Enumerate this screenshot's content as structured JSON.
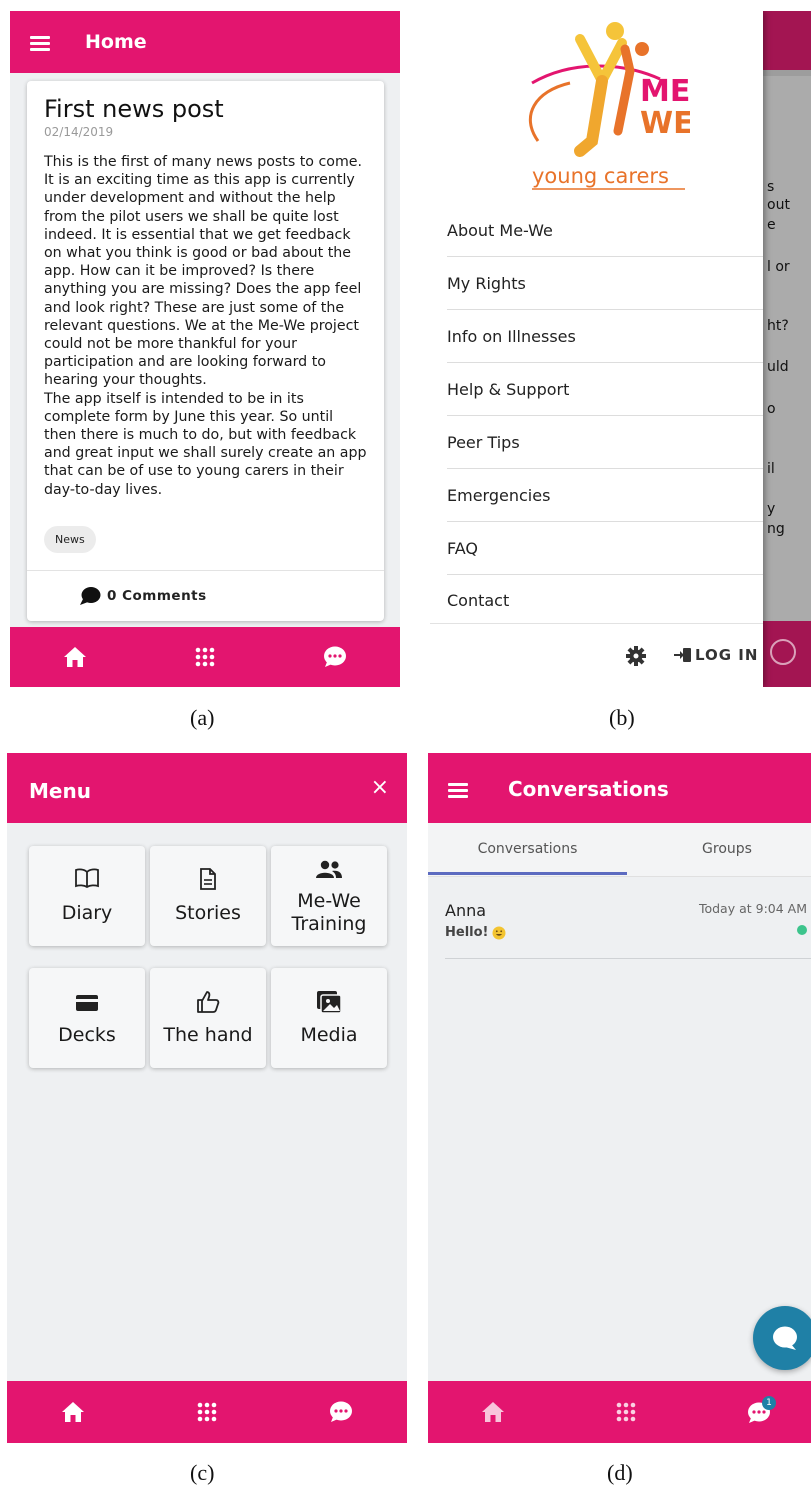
{
  "colors": {
    "brand_pink": "#e3156f",
    "fab_blue": "#1f80a6",
    "tab_underline": "#5c6bc0",
    "online_green": "#3cc48c"
  },
  "captions": {
    "a": "(a)",
    "b": "(b)",
    "c": "(c)",
    "d": "(d)"
  },
  "panel_a": {
    "header_title": "Home",
    "post": {
      "title": "First news post",
      "date": "02/14/2019",
      "body": "This is the first of many news posts to come.\nIt is an exciting time as this app is currently\nunder development and without the help\nfrom the pilot users we shall be quite lost\nindeed. It is essential that we get feedback\non what you think is good or bad about the\napp. How can it be improved? Is there\nanything you are missing? Does the app feel\nand look right? These are just some of the\nrelevant questions. We at the Me-We project\ncould not be more thankful for your\nparticipation and are looking forward to\nhearing your thoughts.\nThe app itself is intended to be in its\ncomplete form by June this year. So until\nthen there is much to do, but with feedback\nand great input we shall surely create an app\nthat can be of use to young carers in their\nday-to-day lives.",
      "tag": "News",
      "comments": "0 Comments"
    },
    "bottom_nav": [
      "home-icon",
      "apps-grid-icon",
      "chat-icon"
    ]
  },
  "panel_b": {
    "logo": {
      "line1": "ME",
      "line2": "WE",
      "tagline": "young carers"
    },
    "menu_items": [
      "About Me-We",
      "My Rights",
      "Info on Illnesses",
      "Help & Support",
      "Peer Tips",
      "Emergencies",
      "FAQ",
      "Contact"
    ],
    "login_label": "LOG IN",
    "background_fragments": [
      "s",
      "out",
      "e",
      "l or",
      "ht?",
      "uld",
      "o",
      "il",
      "y",
      "ng"
    ]
  },
  "panel_c": {
    "header_title": "Menu",
    "close_symbol": "×",
    "tiles": [
      {
        "label": "Diary",
        "icon": "book-icon"
      },
      {
        "label": "Stories",
        "icon": "document-icon"
      },
      {
        "label": "Me-We Training",
        "icon": "people-icon"
      },
      {
        "label": "Decks",
        "icon": "card-icon"
      },
      {
        "label": "The hand",
        "icon": "thumbs-up-icon"
      },
      {
        "label": "Media",
        "icon": "images-icon"
      }
    ]
  },
  "panel_d": {
    "header_title": "Conversations",
    "tabs": [
      "Conversations",
      "Groups"
    ],
    "conversation": {
      "name": "Anna",
      "message": "Hello!",
      "time": "Today at 9:04 AM"
    },
    "chat_badge": "1"
  }
}
